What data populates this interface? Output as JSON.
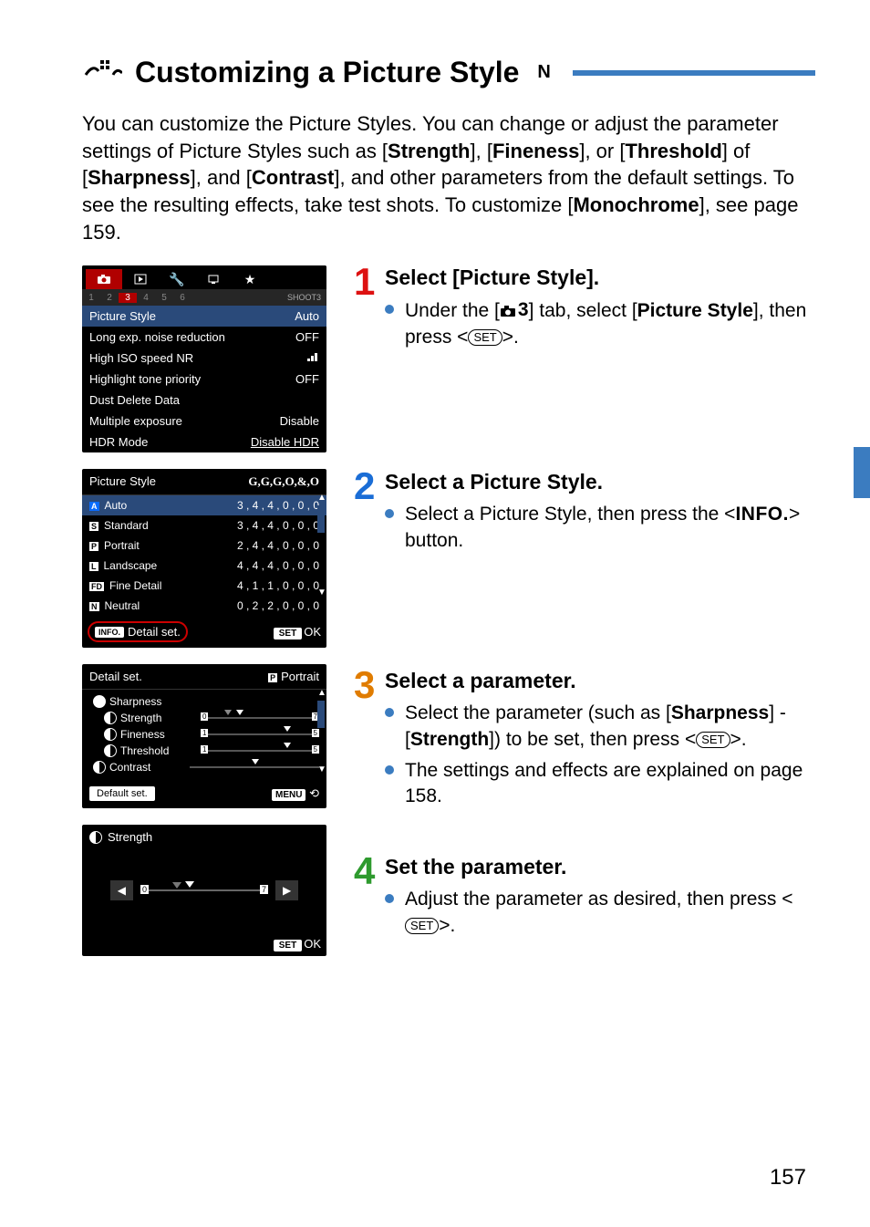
{
  "title": {
    "text": "Customizing a Picture Style",
    "star": "N"
  },
  "intro": {
    "p1a": "You can customize the Picture Styles. You can change or adjust the parameter settings of Picture Styles such as [",
    "b1": "Strength",
    "p1b": "], [",
    "b2": "Fineness",
    "p1c": "], or [",
    "b3": "Threshold",
    "p1d": "] of [",
    "b4": "Sharpness",
    "p1e": "], and [",
    "b5": "Contrast",
    "p1f": "], and other parameters from the default settings. To see the resulting effects, take test shots. To customize [",
    "b6": "Monochrome",
    "p1g": "], see page 159."
  },
  "screen1": {
    "subnums": [
      "1",
      "2",
      "3",
      "4",
      "5",
      "6"
    ],
    "shoot": "SHOOT3",
    "rows": [
      {
        "l": "Picture Style",
        "r": "Auto",
        "sel": true
      },
      {
        "l": "Long exp. noise reduction",
        "r": "OFF"
      },
      {
        "l": "High ISO speed NR",
        "r": "bars"
      },
      {
        "l": "Highlight tone priority",
        "r": "OFF"
      },
      {
        "l": "Dust Delete Data",
        "r": ""
      },
      {
        "l": "Multiple exposure",
        "r": "Disable"
      },
      {
        "l": "HDR Mode",
        "r": "Disable HDR"
      }
    ]
  },
  "screen2": {
    "title": "Picture Style",
    "icons_header": "G,G,G,O,&,O",
    "rows": [
      {
        "tag": "A",
        "name": "Auto",
        "vals": "3 , 4 , 4 , 0 , 0 , 0",
        "sel": true
      },
      {
        "tag": "S",
        "name": "Standard",
        "vals": "3 , 4 , 4 , 0 , 0 , 0"
      },
      {
        "tag": "P",
        "name": "Portrait",
        "vals": "2 , 4 , 4 , 0 , 0 , 0"
      },
      {
        "tag": "L",
        "name": "Landscape",
        "vals": "4 , 4 , 4 , 0 , 0 , 0"
      },
      {
        "tag": "FD",
        "name": "Fine Detail",
        "vals": "4 , 1 , 1 , 0 , 0 , 0"
      },
      {
        "tag": "N",
        "name": "Neutral",
        "vals": "0 , 2 , 2 , 0 , 0 , 0"
      }
    ],
    "info": "INFO.",
    "detail": "Detail set.",
    "set": "SET",
    "ok": "OK"
  },
  "screen3": {
    "title": "Detail set.",
    "style_tag": "P",
    "style_name": "Portrait",
    "sharp": "Sharpness",
    "rows": [
      {
        "icon": "half",
        "name": "Strength",
        "lo": "0",
        "hi": "7"
      },
      {
        "icon": "half",
        "name": "Fineness",
        "lo": "1",
        "hi": "5"
      },
      {
        "icon": "half",
        "name": "Threshold",
        "lo": "1",
        "hi": "5"
      }
    ],
    "contrast": "Contrast",
    "default": "Default set.",
    "menu": "MENU"
  },
  "screen4": {
    "title": "Strength",
    "lo": "0",
    "hi": "7",
    "set": "SET",
    "ok": "OK"
  },
  "steps": {
    "s1": {
      "num": "1",
      "h": "Select [Picture Style].",
      "li1a": "Under the [",
      "li1b": " 3",
      "li1c": "] tab, select [",
      "li1d": "Picture Style",
      "li1e": "], then press <",
      "li1f": ">."
    },
    "s2": {
      "num": "2",
      "h": "Select a Picture Style.",
      "li1a": "Select a Picture Style, then press the <",
      "li1b": "INFO.",
      "li1c": "> button."
    },
    "s3": {
      "num": "3",
      "h": "Select a parameter.",
      "li1a": "Select the parameter (such as [",
      "li1b": "Sharpness",
      "li1c": "] - [",
      "li1d": "Strength",
      "li1e": "]) to be set, then press <",
      "li1f": ">.",
      "li2": "The settings and effects are explained on page 158."
    },
    "s4": {
      "num": "4",
      "h": "Set the parameter.",
      "li1a": "Adjust the parameter as desired, then press <",
      "li1b": ">."
    }
  },
  "set_label": "SET",
  "page_number": "157"
}
